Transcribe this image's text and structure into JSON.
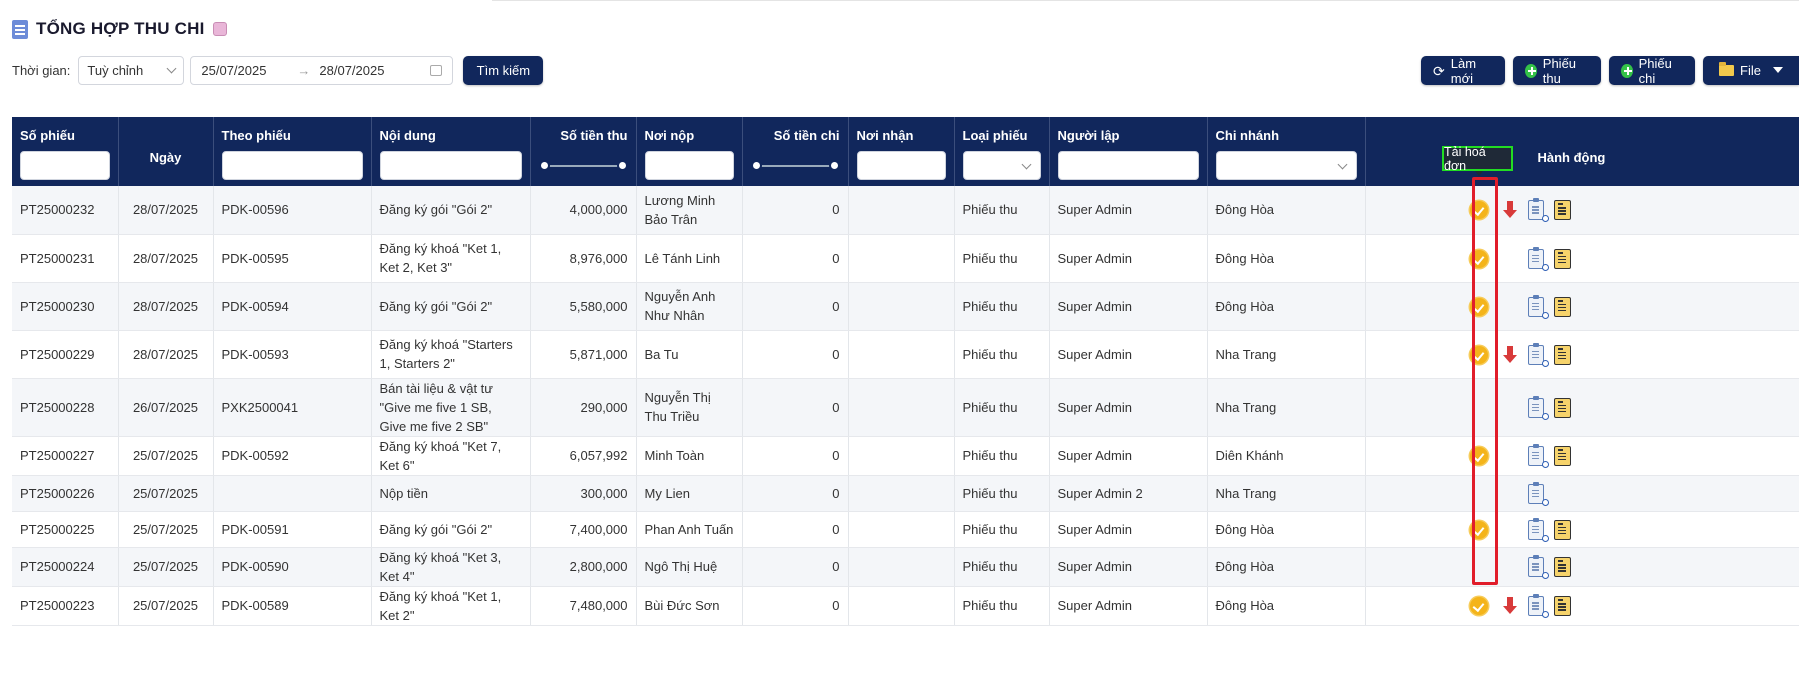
{
  "page": {
    "title": "TỔNG HỢP THU CHI"
  },
  "filters": {
    "time_label": "Thời gian:",
    "time_mode": "Tuỳ chỉnh",
    "date_from": "25/07/2025",
    "date_to": "28/07/2025",
    "range_arrow": "→",
    "search_label": "Tìm kiếm"
  },
  "toolbar": {
    "refresh_label": "Làm mới",
    "receipt_label": "Phiếu thu",
    "payment_label": "Phiếu chi",
    "file_label": "File"
  },
  "table": {
    "columns": {
      "so_phieu": "Số phiếu",
      "ngay": "Ngày",
      "theo_phieu": "Theo phiếu",
      "noi_dung": "Nội dung",
      "so_tien_thu": "Số tiền thu",
      "noi_nop": "Nơi nộp",
      "so_tien_chi": "Số tiền chi",
      "noi_nhan": "Nơi nhận",
      "loai_phieu": "Loại phiếu",
      "nguoi_lap": "Người lập",
      "chi_nhanh": "Chi nhánh",
      "hanh_dong": "Hành động"
    },
    "rows": [
      {
        "so_phieu": "PT25000232",
        "ngay": "28/07/2025",
        "theo_phieu": "PDK-00596",
        "noi_dung": "Đăng ký gói \"Gói 2\"",
        "so_tien_thu": "4,000,000",
        "noi_nop": "Lương Minh Bảo Trân",
        "so_tien_chi": "0",
        "noi_nhan": "",
        "loai_phieu": "Phiếu thu",
        "nguoi_lap": "Super Admin",
        "chi_nhanh": "Đông Hòa"
      },
      {
        "so_phieu": "PT25000231",
        "ngay": "28/07/2025",
        "theo_phieu": "PDK-00595",
        "noi_dung": "Đăng ký khoá \"Ket 1, Ket 2, Ket 3\"",
        "so_tien_thu": "8,976,000",
        "noi_nop": "Lê Tánh Linh",
        "so_tien_chi": "0",
        "noi_nhan": "",
        "loai_phieu": "Phiếu thu",
        "nguoi_lap": "Super Admin",
        "chi_nhanh": "Đông Hòa"
      },
      {
        "so_phieu": "PT25000230",
        "ngay": "28/07/2025",
        "theo_phieu": "PDK-00594",
        "noi_dung": "Đăng ký gói \"Gói 2\"",
        "so_tien_thu": "5,580,000",
        "noi_nop": "Nguyễn Anh Như Nhân",
        "so_tien_chi": "0",
        "noi_nhan": "",
        "loai_phieu": "Phiếu thu",
        "nguoi_lap": "Super Admin",
        "chi_nhanh": "Đông Hòa"
      },
      {
        "so_phieu": "PT25000229",
        "ngay": "28/07/2025",
        "theo_phieu": "PDK-00593",
        "noi_dung": "Đăng ký khoá \"Starters 1, Starters 2\"",
        "so_tien_thu": "5,871,000",
        "noi_nop": "Ba Tu",
        "so_tien_chi": "0",
        "noi_nhan": "",
        "loai_phieu": "Phiếu thu",
        "nguoi_lap": "Super Admin",
        "chi_nhanh": "Nha Trang"
      },
      {
        "so_phieu": "PT25000228",
        "ngay": "26/07/2025",
        "theo_phieu": "PXK2500041",
        "noi_dung": "Bán tài liệu & vật tư \"Give me five 1 SB, Give me five 2 SB\"",
        "so_tien_thu": "290,000",
        "noi_nop": "Nguyễn Thị Thu Triều",
        "so_tien_chi": "0",
        "noi_nhan": "",
        "loai_phieu": "Phiếu thu",
        "nguoi_lap": "Super Admin",
        "chi_nhanh": "Nha Trang"
      },
      {
        "so_phieu": "PT25000227",
        "ngay": "25/07/2025",
        "theo_phieu": "PDK-00592",
        "noi_dung": "Đăng ký khoá \"Ket 7, Ket 6\"",
        "so_tien_thu": "6,057,992",
        "noi_nop": "Minh Toàn",
        "so_tien_chi": "0",
        "noi_nhan": "",
        "loai_phieu": "Phiếu thu",
        "nguoi_lap": "Super Admin",
        "chi_nhanh": "Diên Khánh"
      },
      {
        "so_phieu": "PT25000226",
        "ngay": "25/07/2025",
        "theo_phieu": "",
        "noi_dung": "Nộp tiền",
        "so_tien_thu": "300,000",
        "noi_nop": "My Lien",
        "so_tien_chi": "0",
        "noi_nhan": "",
        "loai_phieu": "Phiếu thu",
        "nguoi_lap": "Super Admin 2",
        "chi_nhanh": "Nha Trang"
      },
      {
        "so_phieu": "PT25000225",
        "ngay": "25/07/2025",
        "theo_phieu": "PDK-00591",
        "noi_dung": "Đăng ký gói \"Gói 2\"",
        "so_tien_thu": "7,400,000",
        "noi_nop": "Phan Anh Tuấn",
        "so_tien_chi": "0",
        "noi_nhan": "",
        "loai_phieu": "Phiếu thu",
        "nguoi_lap": "Super Admin",
        "chi_nhanh": "Đông Hòa"
      },
      {
        "so_phieu": "PT25000224",
        "ngay": "25/07/2025",
        "theo_phieu": "PDK-00590",
        "noi_dung": "Đăng ký khoá \"Ket 3, Ket 4\"",
        "so_tien_thu": "2,800,000",
        "noi_nop": "Ngô Thị Huệ",
        "so_tien_chi": "0",
        "noi_nhan": "",
        "loai_phieu": "Phiếu thu",
        "nguoi_lap": "Super Admin",
        "chi_nhanh": "Đông Hòa"
      },
      {
        "so_phieu": "PT25000223",
        "ngay": "25/07/2025",
        "theo_phieu": "PDK-00589",
        "noi_dung": "Đăng ký khoá \"Ket 1, Ket 2\"",
        "so_tien_thu": "7,480,000",
        "noi_nop": "Bùi Đức Sơn",
        "so_tien_chi": "0",
        "noi_nhan": "",
        "loai_phieu": "Phiếu thu",
        "nguoi_lap": "Super Admin",
        "chi_nhanh": "Đông Hòa"
      }
    ]
  },
  "row_actions": [
    {
      "approve": true,
      "download": true,
      "view": true,
      "invoice": true
    },
    {
      "approve": true,
      "download": false,
      "view": true,
      "invoice": true
    },
    {
      "approve": true,
      "download": false,
      "view": true,
      "invoice": true
    },
    {
      "approve": true,
      "download": true,
      "view": true,
      "invoice": true
    },
    {
      "approve": false,
      "download": false,
      "view": true,
      "invoice": true
    },
    {
      "approve": true,
      "download": false,
      "view": true,
      "invoice": true
    },
    {
      "approve": false,
      "download": false,
      "view": true,
      "invoice": false
    },
    {
      "approve": true,
      "download": false,
      "view": true,
      "invoice": true
    },
    {
      "approve": false,
      "download": false,
      "view": true,
      "invoice": true
    },
    {
      "approve": true,
      "download": true,
      "view": true,
      "invoice": true
    }
  ],
  "tooltip": {
    "text": "Tải hoá đơn"
  },
  "icons": {
    "title": "document-icon",
    "title_badge": "gift-emoji-icon",
    "refresh": "refresh-icon",
    "add": "plus-circle-icon",
    "file": "folder-icon",
    "calendar": "calendar-icon",
    "approve": "check-badge-icon",
    "download": "download-arrow-icon",
    "view": "clipboard-search-icon",
    "invoice": "invoice-icon"
  },
  "colors": {
    "header_bg": "#11275c",
    "approve": "#f4b41a",
    "download": "#d83a3a",
    "highlight_border": "#e11d2a",
    "tooltip_border": "#22dd22"
  }
}
